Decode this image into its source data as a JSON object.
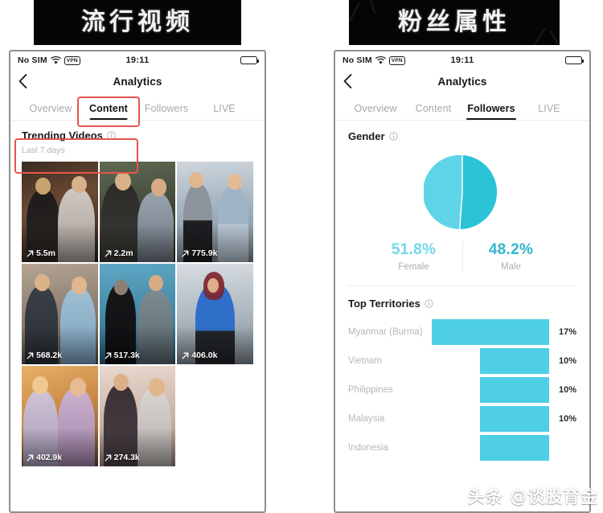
{
  "banners": {
    "left": "流行视频",
    "right": "粉丝属性"
  },
  "watermark": "头条 @谈股育金",
  "colors": {
    "accent_cyan": "#4ecfe6",
    "pie_female": "#5fd4e8",
    "pie_male": "#2cc3d6",
    "annotation_red": "#e8554d",
    "text_primary": "#1a1a1a",
    "text_muted": "#b6b4b4"
  },
  "left_phone": {
    "status_bar": {
      "carrier": "No SIM",
      "wifi_icon": "wifi-icon",
      "vpn_badge": "VPN",
      "time": "19:11",
      "battery_icon": "battery-icon"
    },
    "nav": {
      "back_icon": "back-chevron-icon",
      "title": "Analytics"
    },
    "tabs": [
      {
        "label": "Overview",
        "active": false
      },
      {
        "label": "Content",
        "active": true
      },
      {
        "label": "Followers",
        "active": false
      },
      {
        "label": "LIVE",
        "active": false
      }
    ],
    "section": {
      "title": "Trending Videos",
      "info_icon": "info-icon",
      "subtitle": "Last 7 days"
    },
    "videos": [
      {
        "metric": "5.5m",
        "arrow_icon": "trend-up-arrow-icon"
      },
      {
        "metric": "2.2m",
        "arrow_icon": "trend-up-arrow-icon"
      },
      {
        "metric": "775.9k",
        "arrow_icon": "trend-up-arrow-icon"
      },
      {
        "metric": "568.2k",
        "arrow_icon": "trend-up-arrow-icon"
      },
      {
        "metric": "517.3k",
        "arrow_icon": "trend-up-arrow-icon"
      },
      {
        "metric": "406.0k",
        "arrow_icon": "trend-up-arrow-icon"
      },
      {
        "metric": "402.9k",
        "arrow_icon": "trend-up-arrow-icon"
      },
      {
        "metric": "274.3k",
        "arrow_icon": "trend-up-arrow-icon"
      }
    ]
  },
  "right_phone": {
    "status_bar": {
      "carrier": "No SIM",
      "wifi_icon": "wifi-icon",
      "vpn_badge": "VPN",
      "time": "19:11",
      "battery_icon": "battery-icon"
    },
    "nav": {
      "back_icon": "back-chevron-icon",
      "title": "Analytics"
    },
    "tabs": [
      {
        "label": "Overview",
        "active": false
      },
      {
        "label": "Content",
        "active": false
      },
      {
        "label": "Followers",
        "active": true
      },
      {
        "label": "LIVE",
        "active": false
      }
    ],
    "gender": {
      "title": "Gender",
      "info_icon": "info-icon",
      "female_value": "51.8%",
      "female_label": "Female",
      "male_value": "48.2%",
      "male_label": "Male"
    },
    "territories": {
      "title": "Top Territories",
      "info_icon": "info-icon",
      "rows": [
        {
          "name": "Myanmar (Burma)",
          "pct": "17%"
        },
        {
          "name": "Vietnam",
          "pct": "10%"
        },
        {
          "name": "Philippines",
          "pct": "10%"
        },
        {
          "name": "Malaysia",
          "pct": "10%"
        },
        {
          "name": "Indonesia",
          "pct": ""
        }
      ]
    }
  },
  "chart_data": [
    {
      "type": "pie",
      "title": "Gender",
      "labels": [
        "Female",
        "Male"
      ],
      "values": [
        51.8,
        48.2
      ],
      "value_labels": [
        "51.8%",
        "48.2%"
      ],
      "colors": [
        "#5fd4e8",
        "#2cc3d6"
      ],
      "legend": "below"
    },
    {
      "type": "bar",
      "title": "Top Territories",
      "orientation": "horizontal",
      "categories": [
        "Myanmar (Burma)",
        "Vietnam",
        "Philippines",
        "Malaysia",
        "Indonesia"
      ],
      "values": [
        17,
        10,
        10,
        10,
        10
      ],
      "value_labels": [
        "17%",
        "10%",
        "10%",
        "10%",
        ""
      ],
      "bar_color": "#4ecfe6",
      "xlabel": "",
      "ylabel": "",
      "xlim": [
        0,
        17
      ],
      "grid": false
    }
  ]
}
